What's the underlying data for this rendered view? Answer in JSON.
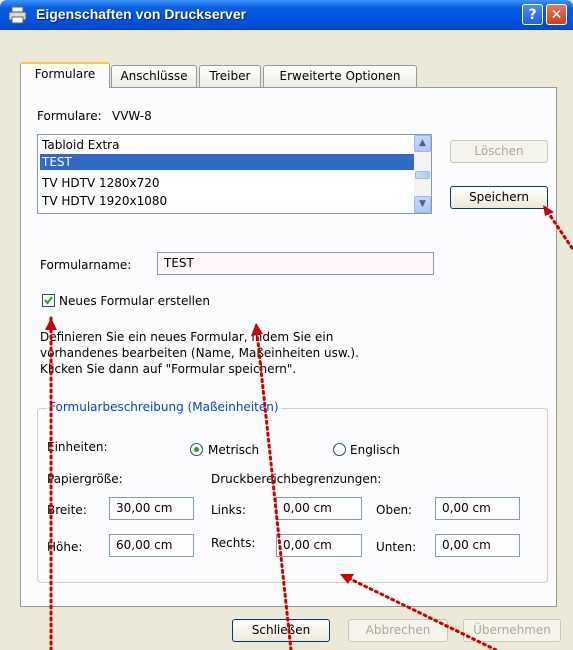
{
  "window": {
    "title": "Eigenschaften von Druckserver",
    "help_glyph": "?",
    "close_glyph": "✕"
  },
  "tabs": [
    "Formulare",
    "Anschlüsse",
    "Treiber",
    "Erweiterte Optionen"
  ],
  "forms": {
    "label": "Formulare:",
    "server": "VVW-8",
    "items": [
      "Tabloid Extra",
      "TEST",
      "TV HDTV 1280x720",
      "TV HDTV 1920x1080"
    ],
    "selected_index": 1,
    "delete_label": "Löschen",
    "save_label": "Speichern"
  },
  "form_name": {
    "label": "Formularname:",
    "value": "TEST"
  },
  "new_form": {
    "label": "Neues Formular erstellen",
    "checked": true
  },
  "description": [
    "Definieren Sie ein neues Formular, indem Sie ein",
    "vorhandenes bearbeiten (Name, Maßeinheiten usw.).",
    "Klicken Sie dann auf \"Formular speichern\"."
  ],
  "measure": {
    "title": "Formularbeschreibung (Maßeinheiten)",
    "units_label": "Einheiten:",
    "metric_label": "Metrisch",
    "english_label": "Englisch",
    "paper_size_label": "Papiergröße:",
    "print_area_label": "Druckbereichbegrenzungen:",
    "width_label": "Breite:",
    "width_value": "30,00 cm",
    "height_label": "Höhe:",
    "height_value": "60,00 cm",
    "left_label": "Links:",
    "left_value": "0,00 cm",
    "right_label": "Rechts:",
    "right_value": "0,00 cm",
    "top_label": "Oben:",
    "top_value": "0,00 cm",
    "bottom_label": "Unten:",
    "bottom_value": "0,00 cm"
  },
  "footer": {
    "close_label": "Schließen",
    "cancel_label": "Abbrechen",
    "apply_label": "Übernehmen"
  },
  "colors": {
    "annotation": "#cc0000",
    "selection": "#316ac5",
    "group_title": "#0046d5"
  }
}
